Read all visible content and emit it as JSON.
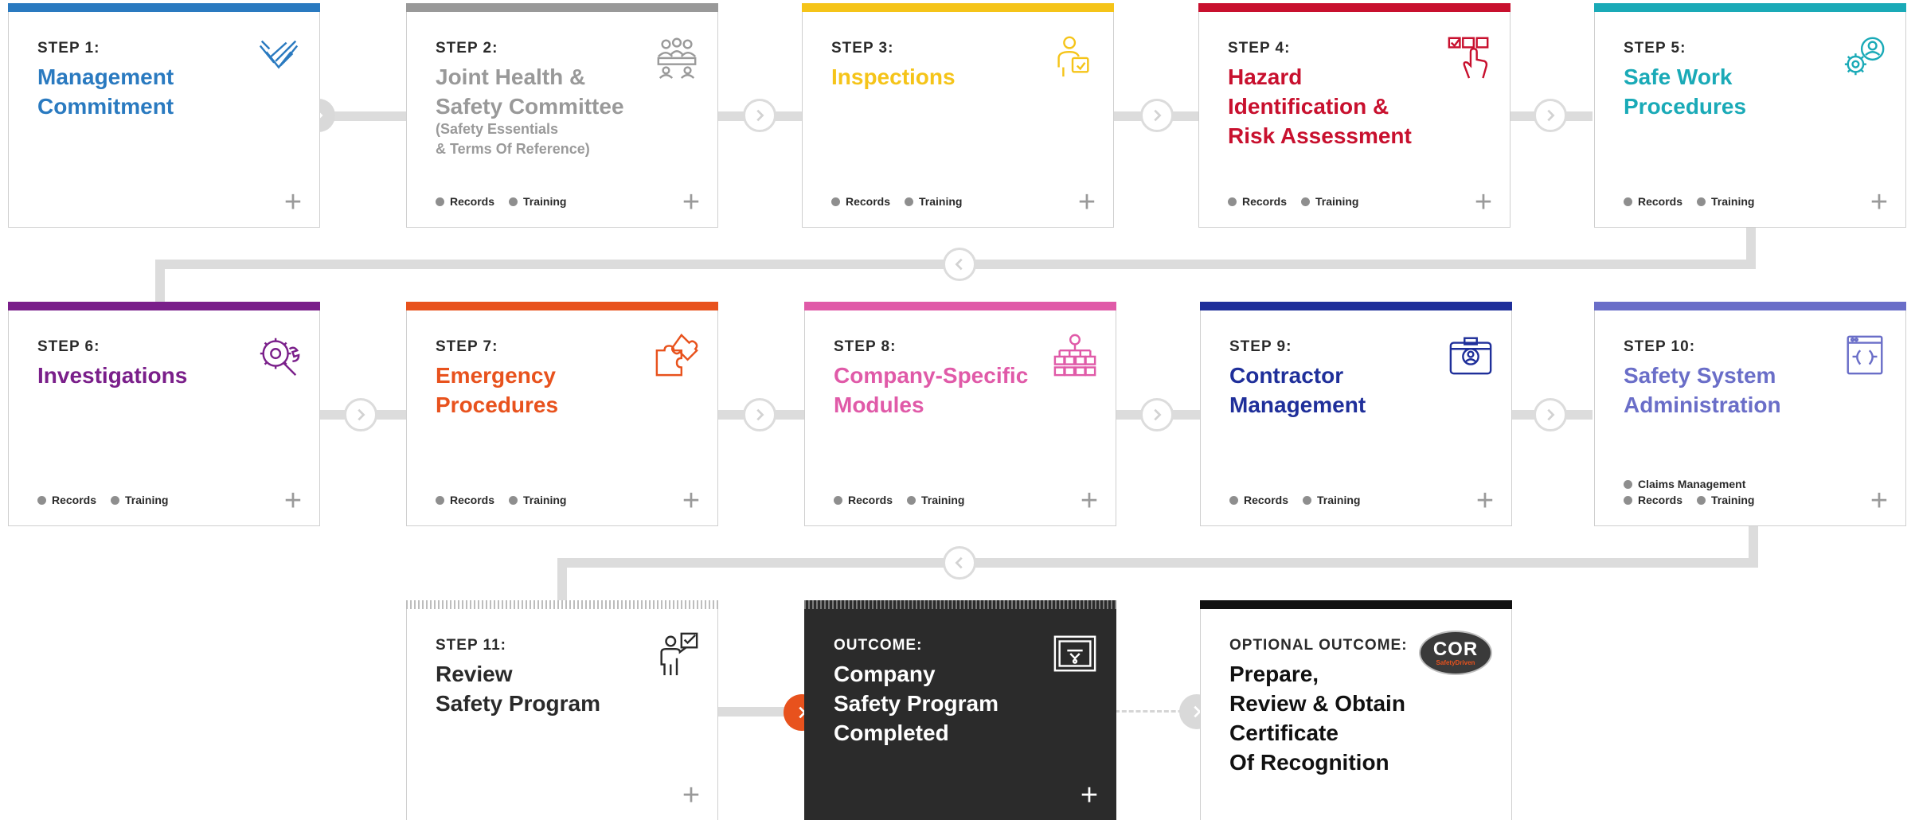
{
  "colors": {
    "step1": "#2a7ac0",
    "step2": "#999999",
    "step3": "#f5c419",
    "step4": "#c8102e",
    "step5": "#1aaab7",
    "step6": "#7a1f8a",
    "step7": "#e8521d",
    "step8": "#e05aa8",
    "step9": "#1f2f9a",
    "step10": "#6a6ec8",
    "connector": "#dcdcdc",
    "accent": "#e8521d",
    "outcome_bg": "#2b2b2b"
  },
  "tags": {
    "records": "Records",
    "training": "Training",
    "claims": "Claims Management"
  },
  "steps": [
    {
      "step": "STEP 1:",
      "title": "Management\nCommitment",
      "icon": "handshake-icon"
    },
    {
      "step": "STEP 2:",
      "title": "Joint Health &\nSafety Committee",
      "subtitle": "(Safety Essentials\n& Terms Of Reference)",
      "icon": "meeting-icon"
    },
    {
      "step": "STEP 3:",
      "title": "Inspections",
      "icon": "inspector-clipboard-icon"
    },
    {
      "step": "STEP 4:",
      "title": "Hazard\nIdentification &\nRisk Assessment",
      "icon": "checklist-hand-icon"
    },
    {
      "step": "STEP 5:",
      "title": "Safe Work\nProcedures",
      "icon": "gear-person-icon"
    },
    {
      "step": "STEP 6:",
      "title": "Investigations",
      "icon": "gear-wrench-icon"
    },
    {
      "step": "STEP 7:",
      "title": "Emergency\nProcedures",
      "icon": "puzzle-icon"
    },
    {
      "step": "STEP 8:",
      "title": "Company-Specific\nModules",
      "icon": "org-chart-icon"
    },
    {
      "step": "STEP 9:",
      "title": "Contractor\nManagement",
      "icon": "id-badge-icon"
    },
    {
      "step": "STEP 10:",
      "title": "Safety System\nAdministration",
      "icon": "browser-window-icon"
    },
    {
      "step": "STEP 11:",
      "title": "Review\nSafety Program",
      "icon": "person-checklist-icon"
    }
  ],
  "outcome": {
    "label": "OUTCOME:",
    "title": "Company\nSafety Program\nCompleted",
    "icon": "certificate-icon"
  },
  "optional": {
    "label": "OPTIONAL OUTCOME:",
    "title": "Prepare,\nReview & Obtain\nCertificate\nOf Recognition",
    "logo_text": "COR",
    "logo_sub": "SafetyDriven"
  }
}
